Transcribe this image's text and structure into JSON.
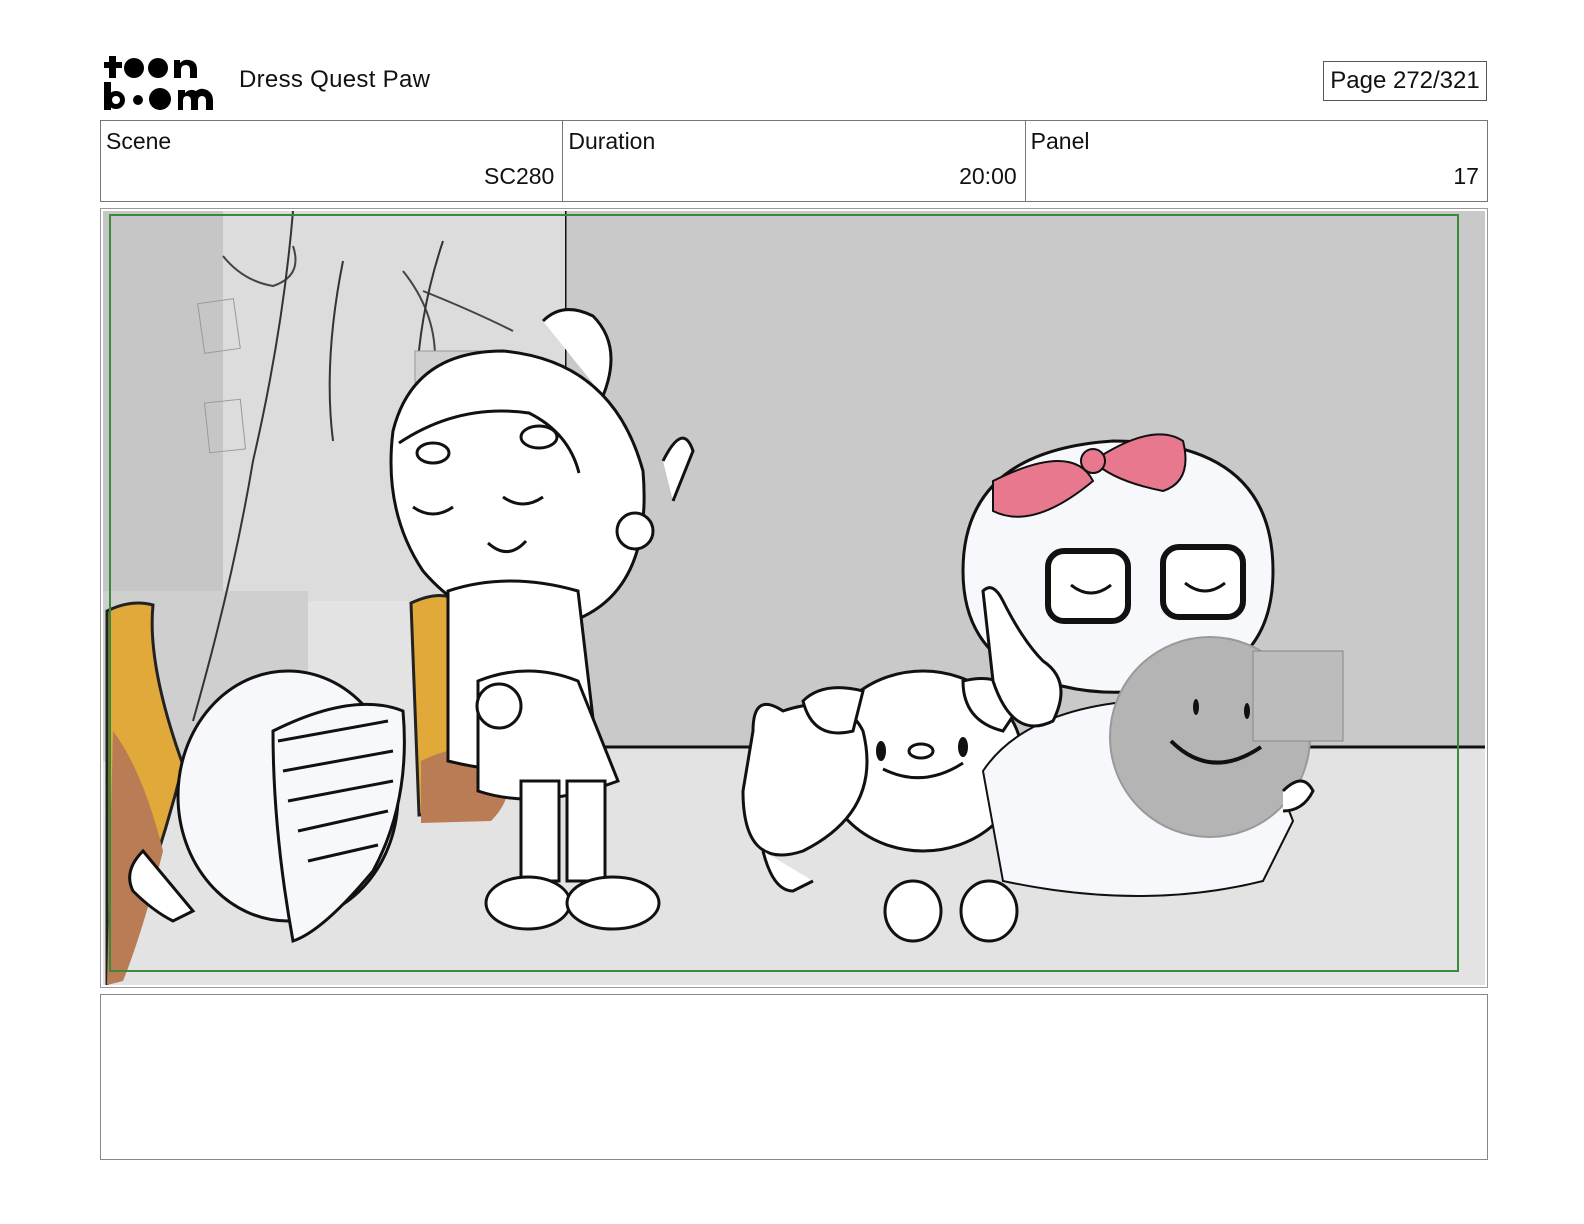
{
  "header": {
    "logo_text": "toon boom",
    "project_title": "Dress Quest Paw",
    "page_label": "Page 272/321"
  },
  "info": {
    "scene_label": "Scene",
    "scene_value": "SC280",
    "duration_label": "Duration",
    "duration_value": "20:00",
    "panel_label": "Panel",
    "panel_value": "17"
  },
  "notes": {
    "text": ""
  },
  "colors": {
    "safe_frame": "#3a8a3a",
    "bow_pink": "#e8788e",
    "wall_gray": "#c8c8c8",
    "floor_gray": "#e4e4e4",
    "shield_gray": "#b4b4b4",
    "ochre": "#e0a93a",
    "brown": "#b97c55"
  }
}
